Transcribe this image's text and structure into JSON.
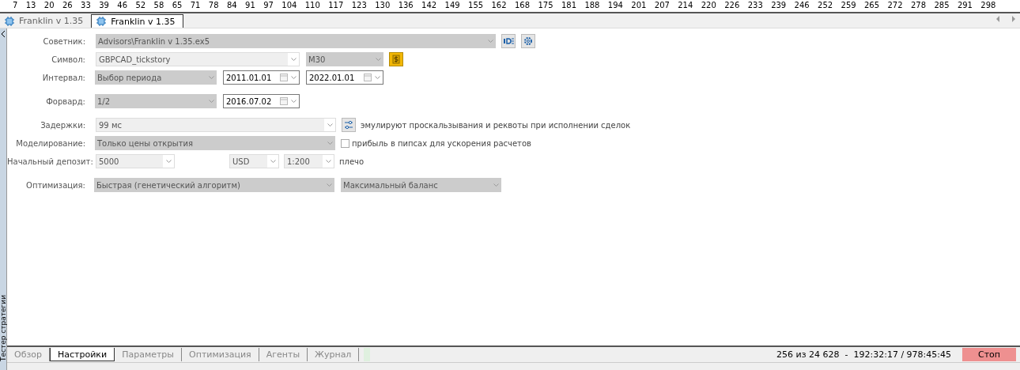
{
  "ruler": {
    "ticks": [
      "7",
      "13",
      "20",
      "26",
      "33",
      "39",
      "46",
      "52",
      "58",
      "65",
      "71",
      "78",
      "84",
      "91",
      "97",
      "104",
      "110",
      "117",
      "123",
      "130",
      "136",
      "142",
      "149",
      "155",
      "162",
      "168",
      "175",
      "181",
      "188",
      "194",
      "201",
      "207",
      "214",
      "220",
      "226",
      "233",
      "239",
      "246",
      "252",
      "259",
      "265",
      "272",
      "278",
      "285",
      "291",
      "298"
    ]
  },
  "chart_tabs": [
    {
      "label": "Franklin v 1.35",
      "selected": false
    },
    {
      "label": "Franklin v 1.35",
      "selected": true
    }
  ],
  "side_panel": {
    "title": "Тестер стратегии"
  },
  "form": [
    {
      "label": "Советник:",
      "fields": [
        {
          "kind": "dropdown",
          "value": "Advisors\\Franklin v 1.35.ex5",
          "disabled": true
        }
      ],
      "extras": [
        {
          "kind": "ide"
        },
        {
          "kind": "gear"
        }
      ]
    },
    {
      "label": "Символ:",
      "fields": [
        {
          "kind": "dropdown",
          "value": "GBPCAD_tickstory",
          "disabled": false
        },
        {
          "kind": "dropdown",
          "value": "M30",
          "disabled": true
        }
      ],
      "extras": [
        {
          "kind": "dollar"
        }
      ]
    },
    {
      "label": "Интервал:",
      "fields": [
        {
          "kind": "dropdown",
          "value": "Выбор периода",
          "disabled": true
        },
        {
          "kind": "date",
          "value": "2011.01.01"
        },
        {
          "kind": "date",
          "value": "2022.01.01"
        }
      ]
    },
    {
      "label": "Форвард:",
      "fields": [
        {
          "kind": "dropdown",
          "value": "1/2",
          "disabled": true
        },
        {
          "kind": "date",
          "value": "2016.07.02"
        }
      ]
    },
    {
      "label": "Задержки:",
      "fields": [
        {
          "kind": "dropdown",
          "value": "99 мс",
          "disabled": false
        }
      ],
      "extras": [
        {
          "kind": "sliders"
        }
      ],
      "note": "эмулируют проскальзывания и реквоты при исполнении сделок"
    },
    {
      "label": "Моделирование:",
      "fields": [
        {
          "kind": "dropdown",
          "value": "Только цены открытия",
          "disabled": true
        }
      ],
      "checkbox": {
        "label": "прибыль в пипсах для ускорения расчетов",
        "checked": false
      }
    },
    {
      "label": "Начальный депозит:",
      "fields": [
        {
          "kind": "dropdown",
          "value": "5000",
          "disabled": false
        },
        {
          "kind": "dropdown",
          "value": "USD",
          "disabled": false
        },
        {
          "kind": "dropdown",
          "value": "1:200",
          "disabled": false
        }
      ],
      "note": "плечо"
    },
    {
      "label": "Оптимизация:",
      "fields": [
        {
          "kind": "dropdown",
          "value": "Быстрая (генетический алгоритм)",
          "disabled": true
        },
        {
          "kind": "dropdown",
          "value": "Максимальный баланс",
          "disabled": true
        }
      ]
    }
  ],
  "bottom_tabs": [
    {
      "label": "Обзор",
      "selected": false
    },
    {
      "label": "Настройки",
      "selected": true
    },
    {
      "label": "Параметры",
      "selected": false
    },
    {
      "label": "Оптимизация",
      "selected": false
    },
    {
      "label": "Агенты",
      "selected": false
    },
    {
      "label": "Журнал",
      "selected": false
    }
  ],
  "status": {
    "progress": "256 из 24 628  -  192:32:17 / 978:45:45",
    "stop_button": "Стоп"
  }
}
